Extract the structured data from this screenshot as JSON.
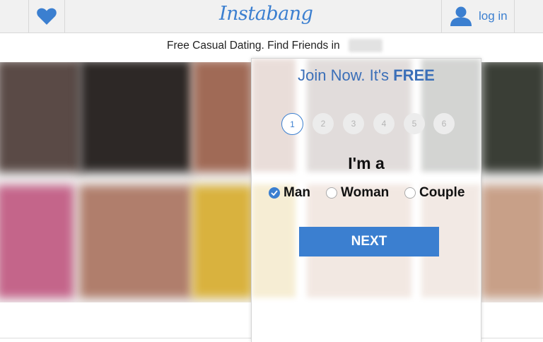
{
  "header": {
    "logo_text": "Instabang",
    "login_label": "log in",
    "brand_color": "#3b7fd0",
    "left_icon": "heart-icon",
    "login_icon": "user-icon"
  },
  "tagline": {
    "text": "Free Casual Dating. Find Friends in"
  },
  "modal": {
    "title_prefix": "Join Now. It's",
    "title_emphasis": "FREE",
    "steps": [
      "1",
      "2",
      "3",
      "4",
      "5",
      "6"
    ],
    "active_step": "1",
    "question": "I'm a",
    "options": [
      {
        "label": "Man",
        "selected": true
      },
      {
        "label": "Woman",
        "selected": false
      },
      {
        "label": "Couple",
        "selected": false
      }
    ],
    "next_label": "NEXT"
  }
}
